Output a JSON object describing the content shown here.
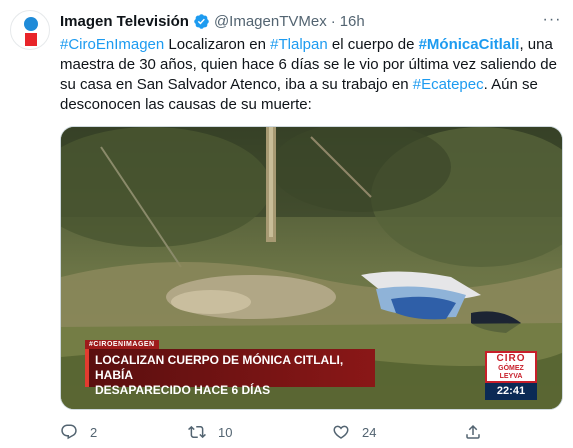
{
  "tweet": {
    "author": {
      "name": "Imagen Televisión",
      "handle": "@ImagenTVMex",
      "separator": "·",
      "time": "16h"
    },
    "more_label": "···",
    "text": {
      "t1": "#CiroEnImagen",
      "t2": " Localizaron en ",
      "t3": "#Tlalpan",
      "t4": " el cuerpo de ",
      "t5": "#MónicaCitlali",
      "t6": ", una maestra de 30 años, quien hace 6 días se le vio por última vez saliendo de su casa en San Salvador Atenco, iba a su trabajo en ",
      "t7": "#Ecatepec",
      "t8": ". Aún se desconocen las causas de su muerte:"
    },
    "media": {
      "overlay_tag": "#CIROENIMAGEN",
      "headline_line1": "LOCALIZAN CUERPO DE MÓNICA CITLALI, HABÍA",
      "headline_line2": "DESAPARECIDO HACE 6 DÍAS",
      "logo_line1": "CIRO",
      "logo_line2": "GÓMEZ",
      "logo_line3": "LEYVA",
      "clock": "22:41"
    },
    "actions": {
      "reply_count": "2",
      "retweet_count": "10",
      "like_count": "24"
    }
  },
  "icons": {
    "verified": "verified-badge-icon",
    "more": "more-icon",
    "reply": "reply-icon",
    "retweet": "retweet-icon",
    "like": "heart-icon",
    "share": "share-icon"
  },
  "colors": {
    "link": "#1d9bf0",
    "secondary_text": "#536471",
    "verified": "#1d9bf0",
    "avatar_blue": "#1f8bd8",
    "avatar_red": "#e8252a"
  }
}
